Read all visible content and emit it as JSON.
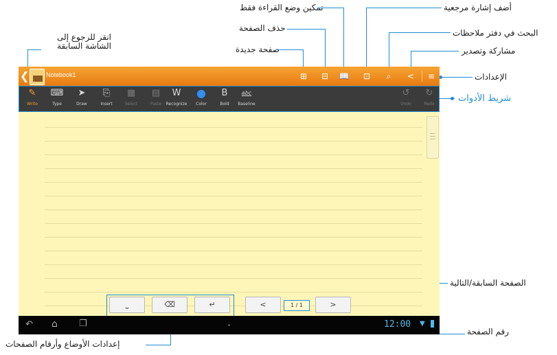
{
  "annotations": {
    "back": "انقر للرجوع إلى الشاشة السابقة",
    "read_only": "تمكين وضع القراءة فقط",
    "delete_page": "حذف الصفحة",
    "new_page": "صفحة جديدة",
    "add_bookmark": "أضف إشارة مرجعية",
    "search": "البحث في دفتر ملاحظات",
    "share": "مشاركة وتصدير",
    "settings": "الإعدادات",
    "toolbar": "شريط الأدوات",
    "prev_next": "الصفحة السابقة/التالية",
    "page_number": "رقم الصفحة",
    "mode_settings": "إعدادات الأوضاع وأرقام الصفحات"
  },
  "app": {
    "notebook_title": "Notebook1"
  },
  "toolbar": [
    {
      "label": "Write",
      "icon": "pen-icon",
      "glyph": "✎"
    },
    {
      "label": "Type",
      "icon": "keyboard-icon",
      "glyph": "⌨"
    },
    {
      "label": "Draw",
      "icon": "brush-icon",
      "glyph": "➤"
    },
    {
      "label": "Insert",
      "icon": "insert-icon",
      "glyph": "⎘"
    },
    {
      "label": "Select",
      "icon": "select-icon",
      "glyph": "▦"
    },
    {
      "label": "Paste",
      "icon": "paste-icon",
      "glyph": "▤"
    },
    {
      "label": "Recognize",
      "icon": "recognize-icon",
      "glyph": "W"
    },
    {
      "label": "Color",
      "icon": "color-icon",
      "glyph": "●"
    },
    {
      "label": "Bold",
      "icon": "bold-icon",
      "glyph": "B"
    },
    {
      "label": "Baseline",
      "icon": "baseline-icon",
      "glyph": "abc"
    },
    {
      "label": "Undo",
      "icon": "undo-icon",
      "glyph": "↺"
    },
    {
      "label": "Redo",
      "icon": "redo-icon",
      "glyph": "↻"
    }
  ],
  "pager": {
    "prev": "<",
    "next": ">",
    "page": "1 / 1"
  },
  "status": {
    "time": "12:00"
  },
  "colors": {
    "accent_blue": "#1f8dd6",
    "titlebar_orange": "#ee8a1e",
    "paper": "#fdf6b8"
  }
}
